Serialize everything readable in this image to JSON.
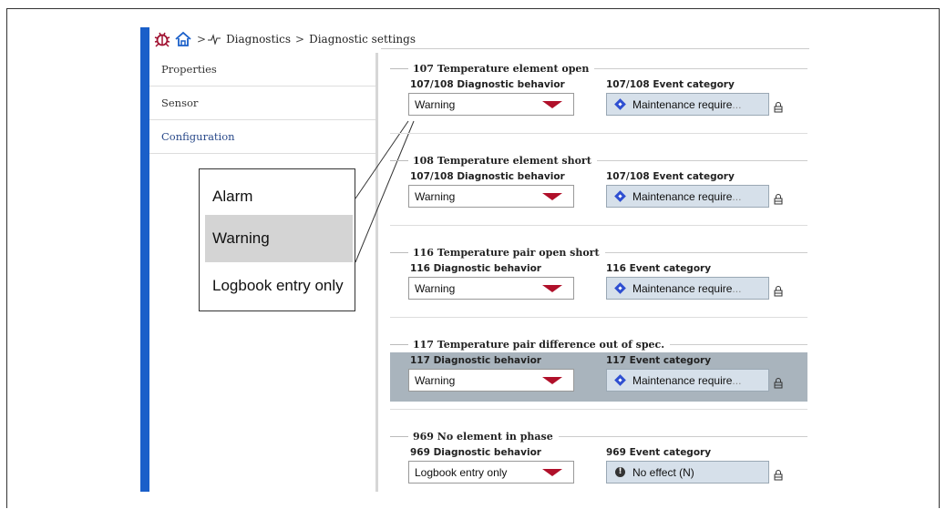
{
  "breadcrumb": {
    "separator1": ">",
    "item1": "Diagnostics",
    "separator2": ">",
    "item2": "Diagnostic settings"
  },
  "nav": {
    "items": [
      {
        "label": "Properties"
      },
      {
        "label": "Sensor"
      },
      {
        "label": "Configuration"
      }
    ]
  },
  "dropdown_options": {
    "alarm": "Alarm",
    "warning": "Warning",
    "logbook": "Logbook entry only"
  },
  "sections": [
    {
      "title": "107 Temperature element open",
      "behavior_label": "107/108 Diagnostic behavior",
      "behavior_value": "Warning",
      "event_label": "107/108 Event category",
      "event_value": "Maintenance require",
      "event_ellipsis": "..."
    },
    {
      "title": "108 Temperature element short",
      "behavior_label": "107/108 Diagnostic behavior",
      "behavior_value": "Warning",
      "event_label": "107/108 Event category",
      "event_value": "Maintenance require",
      "event_ellipsis": "..."
    },
    {
      "title": "116 Temperature pair open short",
      "behavior_label": "116 Diagnostic behavior",
      "behavior_value": "Warning",
      "event_label": "116 Event category",
      "event_value": "Maintenance require",
      "event_ellipsis": "..."
    },
    {
      "title": "117 Temperature pair difference out of spec.",
      "behavior_label": "117 Diagnostic behavior",
      "behavior_value": "Warning",
      "event_label": "117 Event category",
      "event_value": "Maintenance require",
      "event_ellipsis": "..."
    },
    {
      "title": "969 No element in phase",
      "behavior_label": "969 Diagnostic behavior",
      "behavior_value": "Logbook entry only",
      "event_label": "969 Event category",
      "event_value": "No effect (N)",
      "event_ellipsis": ""
    }
  ],
  "colors": {
    "accent_bar": "#1a5fc9",
    "dropdown_arrow": "#b0102a",
    "maintenance_icon": "#2f4fd1",
    "highlight_row": "#a9b4bd"
  }
}
